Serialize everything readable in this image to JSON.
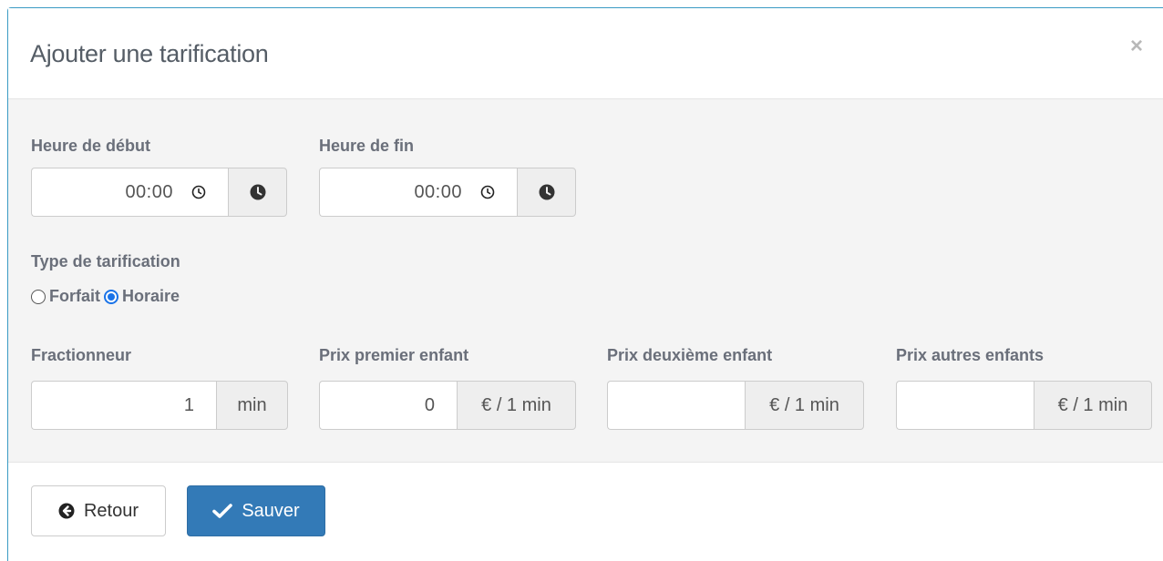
{
  "modal": {
    "title": "Ajouter une tarification",
    "close_label": "×"
  },
  "form": {
    "start_time": {
      "label": "Heure de début",
      "value": "00:00"
    },
    "end_time": {
      "label": "Heure de fin",
      "value": "00:00"
    },
    "pricing_type": {
      "label": "Type de tarification",
      "options": [
        {
          "label": "Forfait",
          "checked": false
        },
        {
          "label": "Horaire",
          "checked": true
        }
      ]
    },
    "fractionneur": {
      "label": "Fractionneur",
      "value": "1",
      "unit": "min"
    },
    "price_first": {
      "label": "Prix premier enfant",
      "value": "0",
      "unit": "€ / 1 min"
    },
    "price_second": {
      "label": "Prix deuxième enfant",
      "value": "",
      "unit": "€ / 1 min"
    },
    "price_others": {
      "label": "Prix autres enfants",
      "value": "",
      "unit": "€ / 1 min"
    }
  },
  "footer": {
    "back_label": "Retour",
    "save_label": "Sauver"
  },
  "colors": {
    "primary": "#337ab7",
    "radio_accent": "#1a73e8",
    "body_bg": "#f4f4f4"
  }
}
